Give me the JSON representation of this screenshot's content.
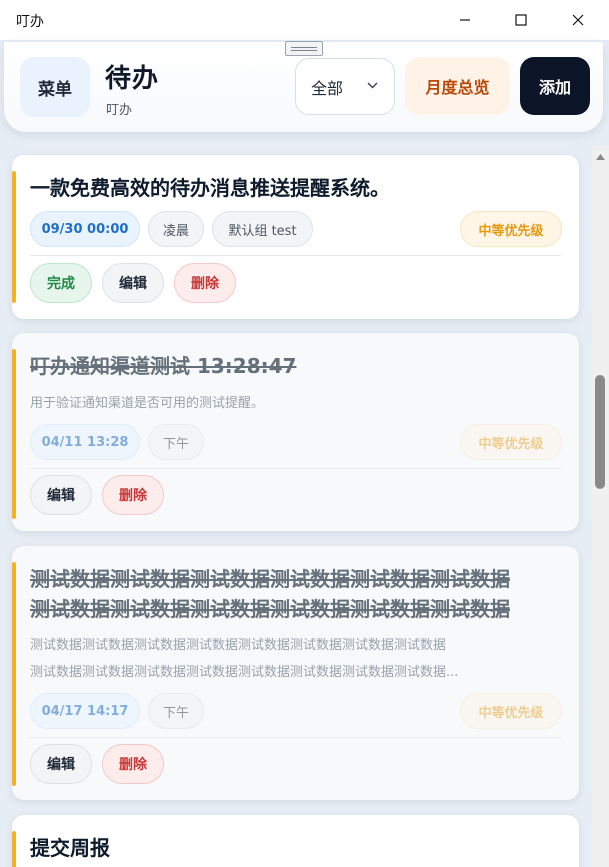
{
  "window": {
    "title": "叮办"
  },
  "header": {
    "menu_label": "菜单",
    "title": "待办",
    "subtitle": "叮办",
    "filter_value": "全部",
    "monthly_label": "月度总览",
    "add_label": "添加"
  },
  "colors": {
    "accent_bar": "#f5b027",
    "add_button_bg": "#0b1527",
    "monthly_text": "#b84a0a"
  },
  "icons": {
    "minimize": "minimize-icon",
    "maximize": "maximize-icon",
    "close": "close-icon",
    "chevron": "chevron-down-icon",
    "scroll_up": "scroll-up-arrow-icon"
  },
  "todos": [
    {
      "title": "一款免费高效的待办消息推送提醒系统。",
      "date": "09/30 00:00",
      "period": "凌晨",
      "group": "默认组 test",
      "priority": "中等优先级",
      "complete_label": "完成",
      "edit_label": "编辑",
      "delete_label": "删除"
    },
    {
      "title": "叮办通知渠道测试 13:28:47",
      "desc": "用于验证通知渠道是否可用的测试提醒。",
      "date": "04/11 13:28",
      "period": "下午",
      "priority": "中等优先级",
      "edit_label": "编辑",
      "delete_label": "删除"
    },
    {
      "title_line1": "测试数据测试数据测试数据测试数据测试数据测试数据",
      "title_line2": "测试数据测试数据测试数据测试数据测试数据测试数据",
      "desc_line1": "测试数据测试数据测试数据测试数据测试数据测试数据测试数据测试数据",
      "desc_line2": "测试数据测试数据测试数据测试数据测试数据测试数据测试数据测试数据...",
      "date": "04/17 14:17",
      "period": "下午",
      "priority": "中等优先级",
      "edit_label": "编辑",
      "delete_label": "删除"
    },
    {
      "title": "提交周报"
    }
  ]
}
